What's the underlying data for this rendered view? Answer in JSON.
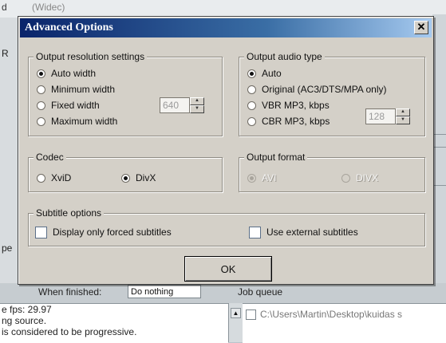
{
  "background": {
    "top_text_1": "d",
    "top_text_2": "(Widec)",
    "left_fragments": [
      "R",
      "pe"
    ],
    "mid_label": "When finished:",
    "mid_combo_value": "Do nothing",
    "job_queue_label": "Job queue",
    "log_lines": [
      "e fps: 29.97",
      "ng source.",
      "is considered to be progressive."
    ],
    "queue_item": "C:\\Users\\Martin\\Desktop\\kuidas s"
  },
  "dialog": {
    "title": "Advanced Options",
    "close_label": "✕",
    "resolution": {
      "legend": "Output resolution settings",
      "options": [
        "Auto width",
        "Minimum width",
        "Fixed width",
        "Maximum width"
      ],
      "selected": "Auto width",
      "fixed_width_value": "640"
    },
    "audio": {
      "legend": "Output audio type",
      "options": [
        "Auto",
        "Original (AC3/DTS/MPA only)",
        "VBR MP3, kbps",
        "CBR MP3, kbps"
      ],
      "selected": "Auto",
      "bitrate_value": "128"
    },
    "codec": {
      "legend": "Codec",
      "options": [
        "XviD",
        "DivX"
      ],
      "selected": "DivX"
    },
    "format": {
      "legend": "Output format",
      "options": [
        "AVI",
        "DIVX"
      ],
      "selected": "AVI"
    },
    "subtitles": {
      "legend": "Subtitle options",
      "forced_label": "Display only forced subtitles",
      "external_label": "Use external subtitles"
    },
    "ok_label": "OK"
  }
}
